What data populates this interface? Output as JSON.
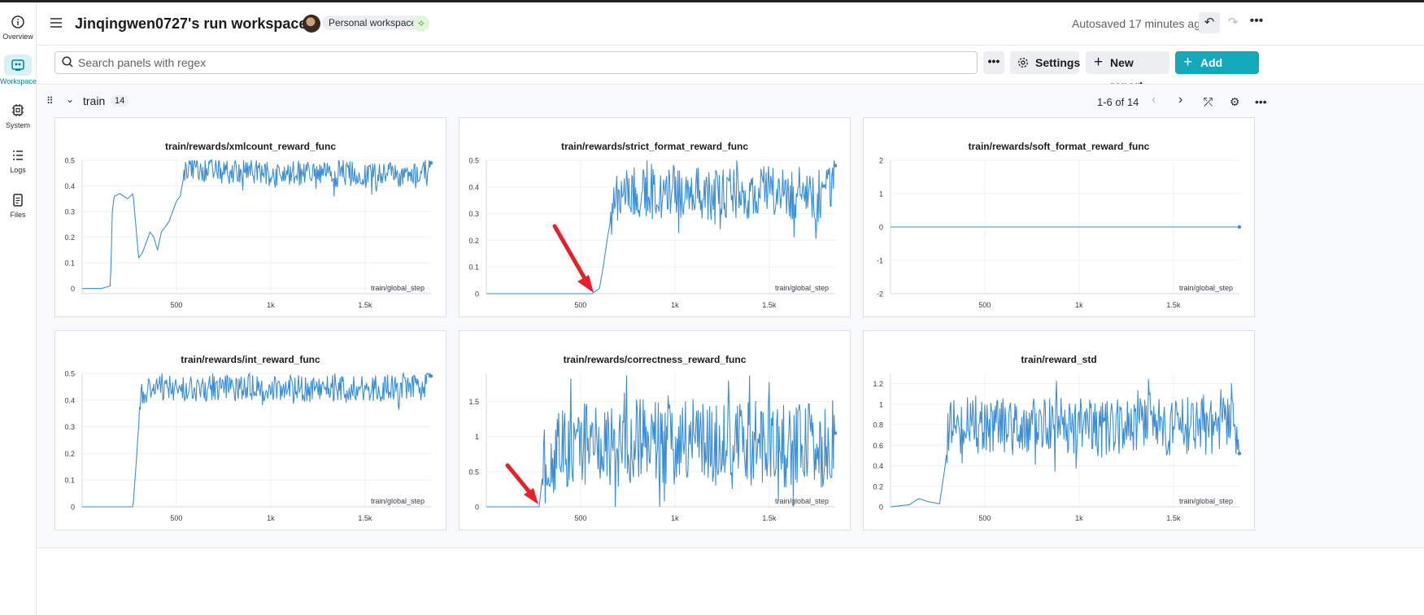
{
  "app": {
    "title": "Jinqingwen0727's run workspace",
    "workspace_label": "Personal workspace",
    "autosaved": "Autosaved 17 minutes ago"
  },
  "rail": {
    "items": [
      {
        "label": "Overview",
        "icon": "info-icon"
      },
      {
        "label": "Workspace",
        "icon": "workspace-icon",
        "active": true
      },
      {
        "label": "System",
        "icon": "chip-icon"
      },
      {
        "label": "Logs",
        "icon": "list-icon"
      },
      {
        "label": "Files",
        "icon": "file-icon"
      }
    ]
  },
  "toolbar": {
    "search_placeholder": "Search panels with regex",
    "settings_label": "Settings",
    "new_report_label": "New report",
    "add_panels_label": "Add panels"
  },
  "section": {
    "title": "train",
    "count": "14",
    "paging": "1-6 of 14"
  },
  "colors": {
    "line": "#3b8fd6",
    "accent": "#13a9ba",
    "arrow": "#e8202a"
  },
  "chart_data": [
    {
      "type": "line",
      "title": "train/rewards/xmlcount_reward_func",
      "xlabel": "train/global_step",
      "xlim": [
        0,
        1850
      ],
      "xticks": [
        500,
        1000,
        1500
      ],
      "xtick_labels": [
        "500",
        "1k",
        "1.5k"
      ],
      "ylim": [
        -0.02,
        0.5
      ],
      "yticks": [
        0,
        0.1,
        0.2,
        0.3,
        0.4,
        0.5
      ],
      "ytick_labels": [
        "0",
        "0.1",
        "0.2",
        "0.3",
        "0.4",
        "0.5"
      ],
      "series": [
        {
          "points": [
            [
              0,
              0
            ],
            [
              100,
              0
            ],
            [
              150,
              0.01
            ],
            [
              160,
              0.3
            ],
            [
              170,
              0.36
            ],
            [
              200,
              0.37
            ],
            [
              240,
              0.35
            ],
            [
              270,
              0.37
            ],
            [
              290,
              0.2
            ],
            [
              300,
              0.12
            ],
            [
              320,
              0.14
            ],
            [
              340,
              0.18
            ],
            [
              360,
              0.22
            ],
            [
              380,
              0.2
            ],
            [
              400,
              0.15
            ],
            [
              420,
              0.22
            ],
            [
              440,
              0.24
            ],
            [
              460,
              0.26
            ],
            [
              480,
              0.3
            ],
            [
              500,
              0.34
            ],
            [
              520,
              0.36
            ],
            [
              540,
              0.44
            ],
            [
              560,
              0.48
            ],
            [
              600,
              0.47
            ],
            [
              700,
              0.46
            ],
            [
              800,
              0.45
            ],
            [
              900,
              0.46
            ],
            [
              1000,
              0.44
            ],
            [
              1100,
              0.45
            ],
            [
              1200,
              0.45
            ],
            [
              1300,
              0.44
            ],
            [
              1400,
              0.45
            ],
            [
              1500,
              0.44
            ],
            [
              1600,
              0.45
            ],
            [
              1700,
              0.44
            ],
            [
              1800,
              0.45
            ],
            [
              1850,
              0.49
            ]
          ],
          "noise": 0.05,
          "noise_from": 540
        }
      ]
    },
    {
      "type": "line",
      "title": "train/rewards/strict_format_reward_func",
      "xlabel": "train/global_step",
      "xlim": [
        0,
        1850
      ],
      "xticks": [
        500,
        1000,
        1500
      ],
      "xtick_labels": [
        "500",
        "1k",
        "1.5k"
      ],
      "ylim": [
        0,
        0.5
      ],
      "yticks": [
        0,
        0.1,
        0.2,
        0.3,
        0.4,
        0.5
      ],
      "ytick_labels": [
        "0",
        "0.1",
        "0.2",
        "0.3",
        "0.4",
        "0.5"
      ],
      "series": [
        {
          "points": [
            [
              0,
              0
            ],
            [
              560,
              0
            ],
            [
              600,
              0.02
            ],
            [
              620,
              0.1
            ],
            [
              640,
              0.2
            ],
            [
              660,
              0.28
            ],
            [
              680,
              0.34
            ],
            [
              700,
              0.38
            ],
            [
              800,
              0.38
            ],
            [
              900,
              0.37
            ],
            [
              1000,
              0.38
            ],
            [
              1100,
              0.38
            ],
            [
              1200,
              0.37
            ],
            [
              1300,
              0.38
            ],
            [
              1400,
              0.37
            ],
            [
              1500,
              0.38
            ],
            [
              1600,
              0.37
            ],
            [
              1700,
              0.38
            ],
            [
              1800,
              0.36
            ],
            [
              1850,
              0.48
            ]
          ],
          "noise": 0.1,
          "noise_from": 660
        }
      ]
    },
    {
      "type": "line",
      "title": "train/rewards/soft_format_reward_func",
      "xlabel": "train/global_step",
      "xlim": [
        0,
        1850
      ],
      "xticks": [
        500,
        1000,
        1500
      ],
      "xtick_labels": [
        "500",
        "1k",
        "1.5k"
      ],
      "ylim": [
        -2,
        2
      ],
      "yticks": [
        -2,
        -1,
        0,
        1,
        2
      ],
      "ytick_labels": [
        "-2",
        "-1",
        "0",
        "1",
        "2"
      ],
      "series": [
        {
          "points": [
            [
              0,
              0
            ],
            [
              1850,
              0
            ]
          ],
          "noise": 0,
          "noise_from": 0
        }
      ]
    },
    {
      "type": "line",
      "title": "train/rewards/int_reward_func",
      "xlabel": "train/global_step",
      "xlim": [
        0,
        1850
      ],
      "xticks": [
        500,
        1000,
        1500
      ],
      "xtick_labels": [
        "500",
        "1k",
        "1.5k"
      ],
      "ylim": [
        0,
        0.5
      ],
      "yticks": [
        0,
        0.1,
        0.2,
        0.3,
        0.4,
        0.5
      ],
      "ytick_labels": [
        "0",
        "0.1",
        "0.2",
        "0.3",
        "0.4",
        "0.5"
      ],
      "series": [
        {
          "points": [
            [
              0,
              0
            ],
            [
              270,
              0
            ],
            [
              290,
              0.2
            ],
            [
              310,
              0.42
            ],
            [
              400,
              0.44
            ],
            [
              500,
              0.45
            ],
            [
              600,
              0.44
            ],
            [
              700,
              0.45
            ],
            [
              800,
              0.44
            ],
            [
              900,
              0.45
            ],
            [
              1000,
              0.44
            ],
            [
              1100,
              0.45
            ],
            [
              1200,
              0.44
            ],
            [
              1300,
              0.45
            ],
            [
              1400,
              0.44
            ],
            [
              1500,
              0.45
            ],
            [
              1600,
              0.44
            ],
            [
              1700,
              0.45
            ],
            [
              1800,
              0.44
            ],
            [
              1850,
              0.49
            ]
          ],
          "noise": 0.05,
          "noise_from": 300
        }
      ]
    },
    {
      "type": "line",
      "title": "train/rewards/correctness_reward_func",
      "xlabel": "train/global_step",
      "xlim": [
        0,
        1850
      ],
      "xticks": [
        500,
        1000,
        1500
      ],
      "xtick_labels": [
        "500",
        "1k",
        "1.5k"
      ],
      "ylim": [
        0,
        1.9
      ],
      "yticks": [
        0,
        0.5,
        1,
        1.5
      ],
      "ytick_labels": [
        "0",
        "0.5",
        "1",
        "1.5"
      ],
      "series": [
        {
          "points": [
            [
              0,
              0
            ],
            [
              280,
              0
            ],
            [
              300,
              0.5
            ],
            [
              400,
              0.8
            ],
            [
              500,
              0.9
            ],
            [
              600,
              0.9
            ],
            [
              700,
              0.85
            ],
            [
              800,
              0.95
            ],
            [
              900,
              0.9
            ],
            [
              1000,
              0.85
            ],
            [
              1100,
              0.95
            ],
            [
              1200,
              0.9
            ],
            [
              1300,
              0.85
            ],
            [
              1400,
              0.9
            ],
            [
              1500,
              0.95
            ],
            [
              1600,
              0.85
            ],
            [
              1700,
              0.9
            ],
            [
              1800,
              0.85
            ],
            [
              1850,
              1.05
            ]
          ],
          "noise": 0.6,
          "noise_from": 300
        }
      ]
    },
    {
      "type": "line",
      "title": "train/reward_std",
      "xlabel": "train/global_step",
      "xlim": [
        0,
        1850
      ],
      "xticks": [
        500,
        1000,
        1500
      ],
      "xtick_labels": [
        "500",
        "1k",
        "1.5k"
      ],
      "ylim": [
        0,
        1.3
      ],
      "yticks": [
        0,
        0.2,
        0.4,
        0.6,
        0.8,
        1,
        1.2
      ],
      "ytick_labels": [
        "0",
        "0.2",
        "0.4",
        "0.6",
        "0.8",
        "1",
        "1.2"
      ],
      "series": [
        {
          "points": [
            [
              0,
              0
            ],
            [
              100,
              0.02
            ],
            [
              150,
              0.08
            ],
            [
              200,
              0.05
            ],
            [
              260,
              0.03
            ],
            [
              290,
              0.4
            ],
            [
              310,
              0.75
            ],
            [
              400,
              0.8
            ],
            [
              500,
              0.78
            ],
            [
              600,
              0.8
            ],
            [
              700,
              0.75
            ],
            [
              800,
              0.8
            ],
            [
              900,
              0.78
            ],
            [
              1000,
              0.8
            ],
            [
              1100,
              0.75
            ],
            [
              1200,
              0.8
            ],
            [
              1300,
              0.78
            ],
            [
              1400,
              0.8
            ],
            [
              1500,
              0.75
            ],
            [
              1600,
              0.8
            ],
            [
              1700,
              0.78
            ],
            [
              1800,
              0.8
            ],
            [
              1850,
              0.52
            ]
          ],
          "noise": 0.28,
          "noise_from": 300
        }
      ]
    }
  ]
}
